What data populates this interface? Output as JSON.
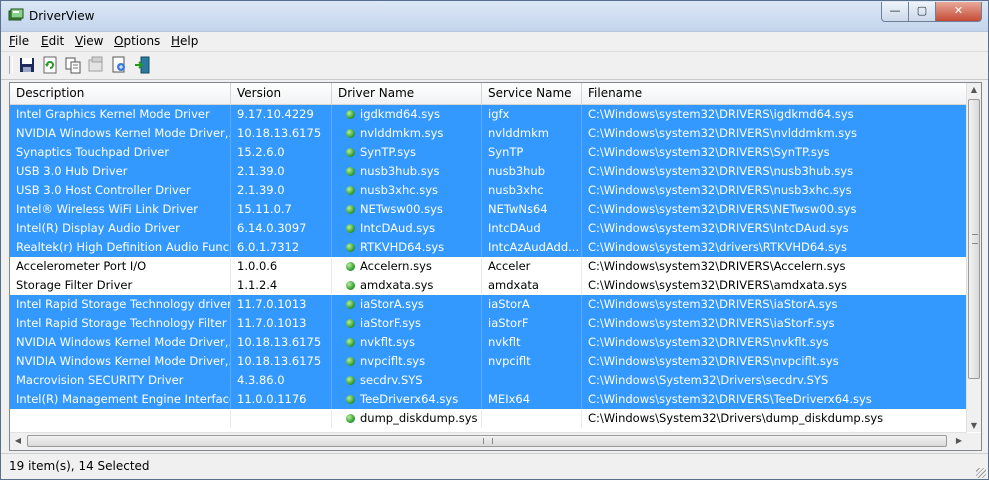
{
  "window": {
    "title": "DriverView",
    "minimize": "—",
    "maximize": "▢",
    "close": "✕"
  },
  "menu": [
    {
      "key": "F",
      "rest": "ile"
    },
    {
      "key": "E",
      "rest": "dit"
    },
    {
      "key": "V",
      "rest": "iew"
    },
    {
      "key": "O",
      "rest": "ptions"
    },
    {
      "key": "H",
      "rest": "elp"
    }
  ],
  "toolbar": [
    "save-icon",
    "refresh-icon",
    "copy-icon",
    "properties-icon",
    "html-report-icon",
    "exit-icon"
  ],
  "columns": [
    "Description",
    "Version",
    "Driver Name",
    "Service Name",
    "Filename"
  ],
  "rows": [
    {
      "selected": true,
      "description": "Intel Graphics Kernel Mode Driver",
      "version": "9.17.10.4229",
      "driver": "igdkmd64.sys",
      "service": "igfx",
      "filename": "C:\\Windows\\system32\\DRIVERS\\igdkmd64.sys"
    },
    {
      "selected": true,
      "description": "NVIDIA Windows Kernel Mode Driver,...",
      "version": "10.18.13.6175",
      "driver": "nvlddmkm.sys",
      "service": "nvlddmkm",
      "filename": "C:\\Windows\\system32\\DRIVERS\\nvlddmkm.sys"
    },
    {
      "selected": true,
      "description": "Synaptics Touchpad Driver",
      "version": "15.2.6.0",
      "driver": "SynTP.sys",
      "service": "SynTP",
      "filename": "C:\\Windows\\system32\\DRIVERS\\SynTP.sys"
    },
    {
      "selected": true,
      "description": "USB 3.0 Hub Driver",
      "version": "2.1.39.0",
      "driver": "nusb3hub.sys",
      "service": "nusb3hub",
      "filename": "C:\\Windows\\system32\\DRIVERS\\nusb3hub.sys"
    },
    {
      "selected": true,
      "description": "USB 3.0 Host Controller Driver",
      "version": "2.1.39.0",
      "driver": "nusb3xhc.sys",
      "service": "nusb3xhc",
      "filename": "C:\\Windows\\system32\\DRIVERS\\nusb3xhc.sys"
    },
    {
      "selected": true,
      "description": "Intel® Wireless WiFi Link Driver",
      "version": "15.11.0.7",
      "driver": "NETwsw00.sys",
      "service": "NETwNs64",
      "filename": "C:\\Windows\\system32\\DRIVERS\\NETwsw00.sys"
    },
    {
      "selected": true,
      "description": "Intel(R) Display Audio Driver",
      "version": "6.14.0.3097",
      "driver": "IntcDAud.sys",
      "service": "IntcDAud",
      "filename": "C:\\Windows\\system32\\DRIVERS\\IntcDAud.sys"
    },
    {
      "selected": true,
      "description": "Realtek(r) High Definition Audio Func...",
      "version": "6.0.1.7312",
      "driver": "RTKVHD64.sys",
      "service": "IntcAzAudAdd...",
      "filename": "C:\\Windows\\system32\\drivers\\RTKVHD64.sys"
    },
    {
      "selected": false,
      "description": "Accelerometer Port I/O",
      "version": "1.0.0.6",
      "driver": "Accelern.sys",
      "service": "Acceler",
      "filename": "C:\\Windows\\system32\\DRIVERS\\Accelern.sys"
    },
    {
      "selected": false,
      "description": "Storage Filter Driver",
      "version": "1.1.2.4",
      "driver": "amdxata.sys",
      "service": "amdxata",
      "filename": "C:\\Windows\\system32\\DRIVERS\\amdxata.sys"
    },
    {
      "selected": true,
      "description": "Intel Rapid Storage Technology driver...",
      "version": "11.7.0.1013",
      "driver": "iaStorA.sys",
      "service": "iaStorA",
      "filename": "C:\\Windows\\system32\\DRIVERS\\iaStorA.sys"
    },
    {
      "selected": true,
      "description": "Intel Rapid Storage Technology Filter ...",
      "version": "11.7.0.1013",
      "driver": "iaStorF.sys",
      "service": "iaStorF",
      "filename": "C:\\Windows\\system32\\DRIVERS\\iaStorF.sys"
    },
    {
      "selected": true,
      "description": "NVIDIA Windows Kernel Mode Driver,...",
      "version": "10.18.13.6175",
      "driver": "nvkflt.sys",
      "service": "nvkflt",
      "filename": "C:\\Windows\\system32\\DRIVERS\\nvkflt.sys"
    },
    {
      "selected": true,
      "description": "NVIDIA Windows Kernel Mode Driver,...",
      "version": "10.18.13.6175",
      "driver": "nvpciflt.sys",
      "service": "nvpciflt",
      "filename": "C:\\Windows\\system32\\DRIVERS\\nvpciflt.sys"
    },
    {
      "selected": true,
      "description": "Macrovision SECURITY Driver",
      "version": "4.3.86.0",
      "driver": "secdrv.SYS",
      "service": "",
      "filename": "C:\\Windows\\System32\\Drivers\\secdrv.SYS"
    },
    {
      "selected": true,
      "description": "Intel(R) Management Engine Interface",
      "version": "11.0.0.1176",
      "driver": "TeeDriverx64.sys",
      "service": "MEIx64",
      "filename": "C:\\Windows\\system32\\DRIVERS\\TeeDriverx64.sys"
    },
    {
      "selected": false,
      "description": "",
      "version": "",
      "driver": "dump_diskdump.sys",
      "service": "",
      "filename": "C:\\Windows\\System32\\Drivers\\dump_diskdump.sys"
    }
  ],
  "status": "19 item(s), 14 Selected",
  "colors": {
    "selection": "#3399ff",
    "titlebar": "#c3d5ec",
    "close": "#c44b34"
  }
}
